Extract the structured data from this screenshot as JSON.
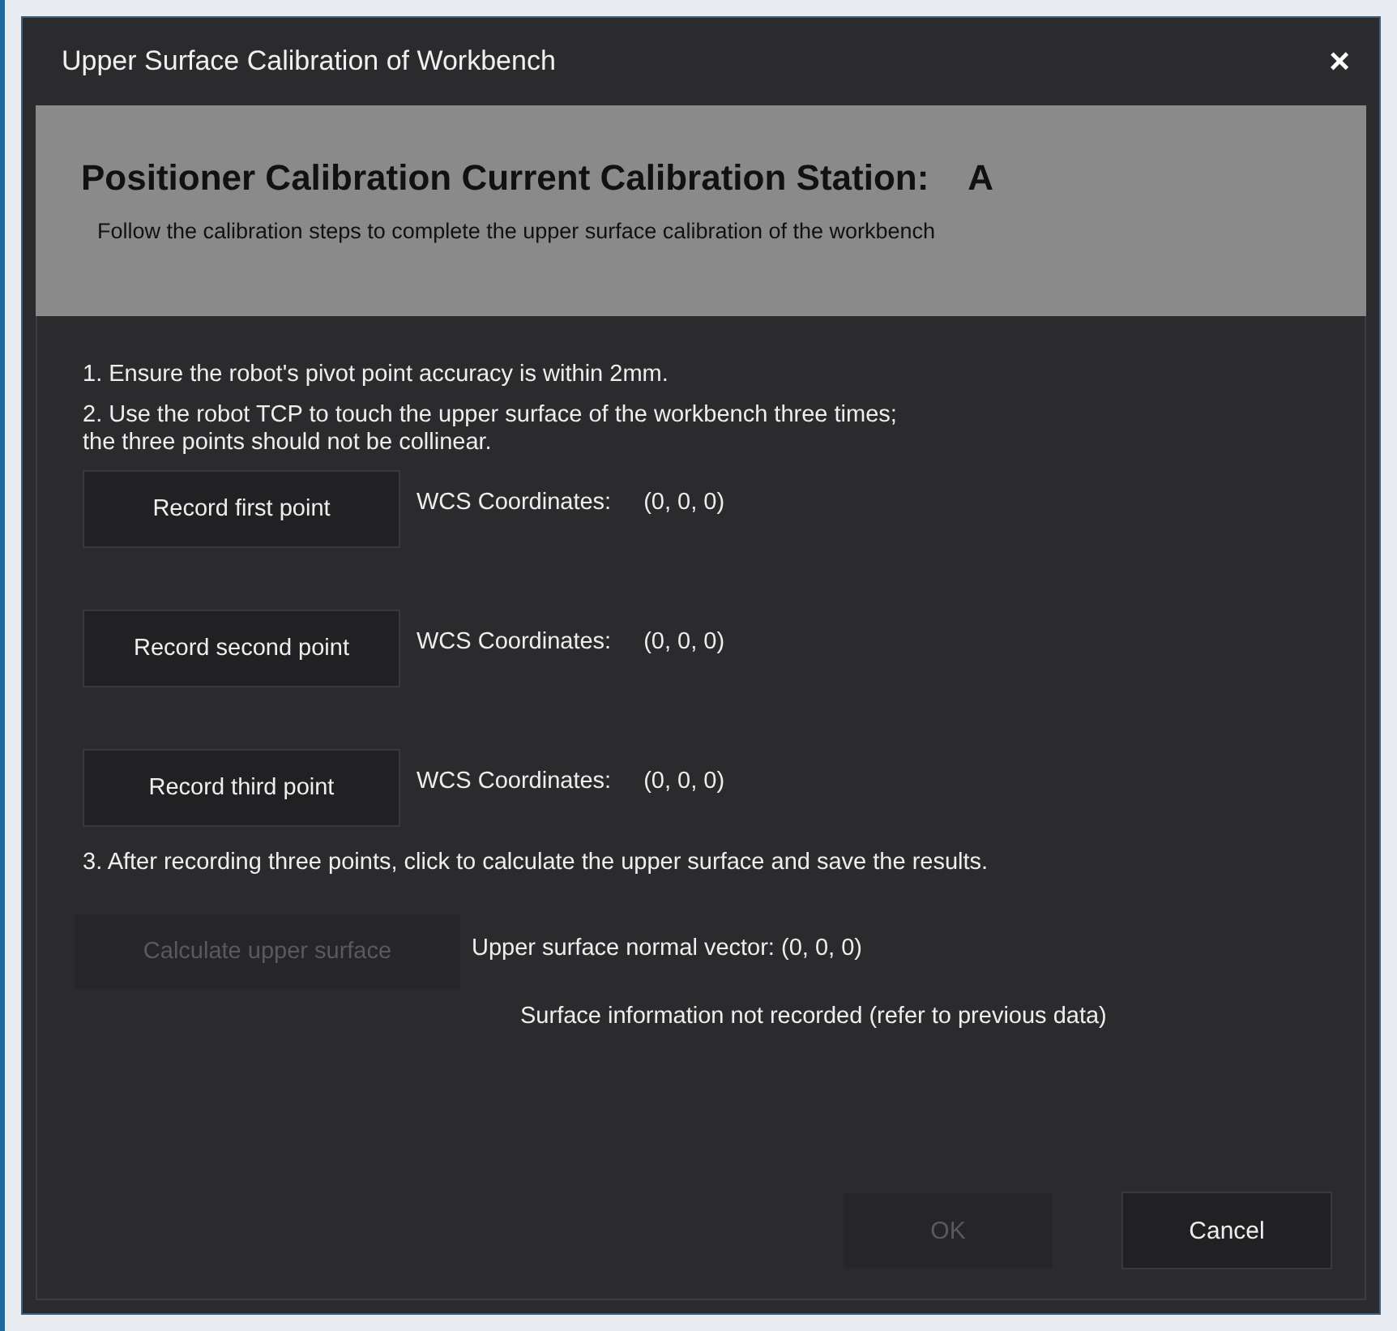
{
  "window": {
    "title": "Upper Surface Calibration of Workbench",
    "close": "×"
  },
  "header": {
    "title": "Positioner Calibration Current Calibration Station:",
    "station": "A",
    "subtitle": "Follow the calibration steps to complete the upper surface calibration of the workbench"
  },
  "steps": [
    "1. Ensure the robot's pivot point accuracy is within 2mm.",
    "2. Use the robot TCP to touch the upper surface of the workbench three times;\nthe three points should not be collinear."
  ],
  "points": [
    {
      "button": "Record first point",
      "label": "WCS Coordinates:",
      "value": "(0, 0, 0)"
    },
    {
      "button": "Record second point",
      "label": "WCS Coordinates:",
      "value": "(0, 0, 0)"
    },
    {
      "button": "Record third point",
      "label": "WCS Coordinates:",
      "value": "(0, 0, 0)"
    }
  ],
  "step3": "3. After recording three points, click to calculate the upper surface and save the results.",
  "calculate": {
    "label": "Calculate upper surface",
    "disabled": true
  },
  "normal_vector": "Upper surface normal vector:  (0, 0, 0)",
  "info": "Surface information not recorded (refer to previous data)",
  "buttons": [
    {
      "label": "OK",
      "disabled": true
    },
    {
      "label": "Cancel",
      "disabled": false
    }
  ]
}
